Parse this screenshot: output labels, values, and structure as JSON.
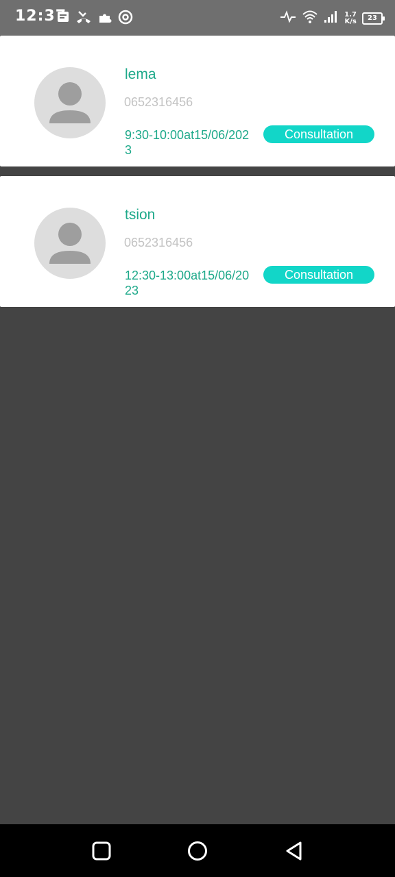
{
  "status_bar": {
    "time": "12:37",
    "net_speed_value": "1.7",
    "net_speed_unit": "K/s",
    "battery_level": "23"
  },
  "appointments": [
    {
      "name": "lema",
      "phone": "0652316456",
      "time": "9:30-10:00at15/06/2023",
      "action_label": "Consultation"
    },
    {
      "name": "tsion",
      "phone": "0652316456",
      "time": "12:30-13:00at15/06/2023",
      "action_label": "Consultation"
    }
  ],
  "colors": {
    "accent_text": "#1ea98a",
    "button_bg": "#12d6c8",
    "phone_text": "#c3c3c3",
    "background": "#444444"
  },
  "icons": {
    "status_left": [
      "message-icon",
      "missed-call-icon",
      "puzzle-icon",
      "at-sign-icon"
    ],
    "status_right": [
      "activity-icon",
      "wifi-icon",
      "signal-icon",
      "battery-icon"
    ],
    "nav": [
      "recents-icon",
      "home-icon",
      "back-icon"
    ]
  }
}
